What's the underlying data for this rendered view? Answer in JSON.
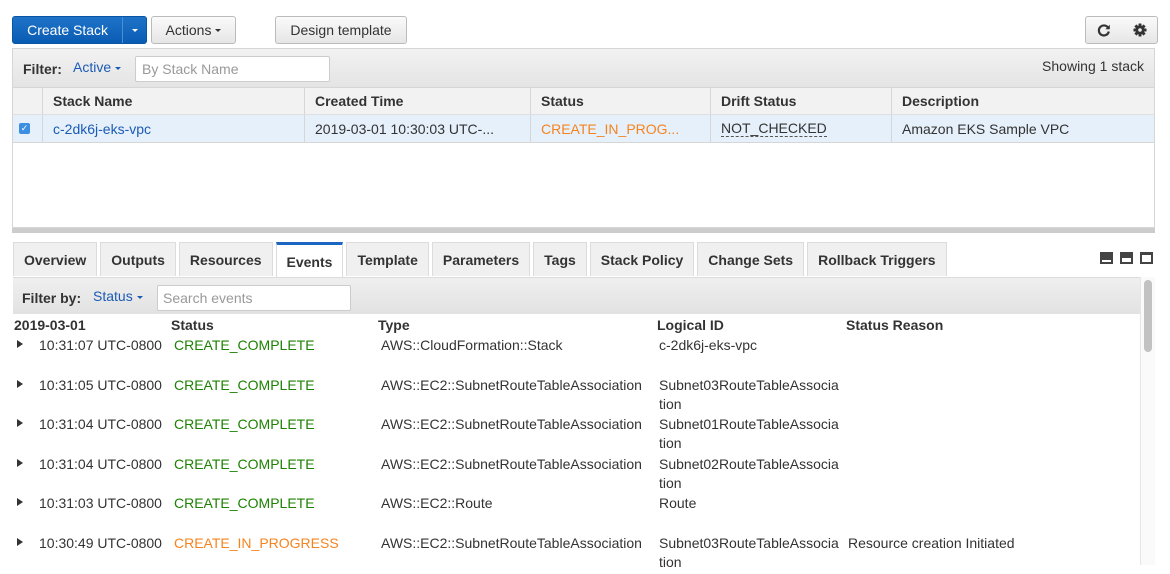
{
  "toolbar": {
    "create_stack": "Create Stack",
    "actions": "Actions",
    "design_template": "Design template",
    "refresh_icon": "refresh-icon",
    "settings_icon": "gear-icon"
  },
  "stack_filter": {
    "label": "Filter:",
    "selected": "Active",
    "placeholder": "By Stack Name",
    "value": "",
    "showing": "Showing 1 stack"
  },
  "stacks_table": {
    "columns": [
      "Stack Name",
      "Created Time",
      "Status",
      "Drift Status",
      "Description"
    ],
    "rows": [
      {
        "selected": true,
        "name": "c-2dk6j-eks-vpc",
        "created": "2019-03-01 10:30:03 UTC-...",
        "status": "CREATE_IN_PROG...",
        "drift": "NOT_CHECKED",
        "description": "Amazon EKS Sample VPC"
      }
    ]
  },
  "tabs": [
    {
      "label": "Overview",
      "active": false
    },
    {
      "label": "Outputs",
      "active": false
    },
    {
      "label": "Resources",
      "active": false
    },
    {
      "label": "Events",
      "active": true
    },
    {
      "label": "Template",
      "active": false
    },
    {
      "label": "Parameters",
      "active": false
    },
    {
      "label": "Tags",
      "active": false
    },
    {
      "label": "Stack Policy",
      "active": false
    },
    {
      "label": "Change Sets",
      "active": false
    },
    {
      "label": "Rollback Triggers",
      "active": false
    }
  ],
  "events_filter": {
    "label": "Filter by:",
    "selected": "Status",
    "placeholder": "Search events",
    "value": ""
  },
  "events_table": {
    "columns": [
      "2019-03-01",
      "Status",
      "Type",
      "Logical ID",
      "Status Reason"
    ],
    "rows": [
      {
        "time": "10:31:07 UTC-0800",
        "status": "CREATE_COMPLETE",
        "status_kind": "complete",
        "type": "AWS::CloudFormation::Stack",
        "logical_id": "c-2dk6j-eks-vpc",
        "reason": ""
      },
      {
        "time": "10:31:05 UTC-0800",
        "status": "CREATE_COMPLETE",
        "status_kind": "complete",
        "type": "AWS::EC2::SubnetRouteTableAssociation",
        "logical_id": "Subnet03RouteTableAssociation",
        "reason": ""
      },
      {
        "time": "10:31:04 UTC-0800",
        "status": "CREATE_COMPLETE",
        "status_kind": "complete",
        "type": "AWS::EC2::SubnetRouteTableAssociation",
        "logical_id": "Subnet01RouteTableAssociation",
        "reason": ""
      },
      {
        "time": "10:31:04 UTC-0800",
        "status": "CREATE_COMPLETE",
        "status_kind": "complete",
        "type": "AWS::EC2::SubnetRouteTableAssociation",
        "logical_id": "Subnet02RouteTableAssociation",
        "reason": ""
      },
      {
        "time": "10:31:03 UTC-0800",
        "status": "CREATE_COMPLETE",
        "status_kind": "complete",
        "type": "AWS::EC2::Route",
        "logical_id": "Route",
        "reason": ""
      },
      {
        "time": "10:30:49 UTC-0800",
        "status": "CREATE_IN_PROGRESS",
        "status_kind": "in_progress",
        "type": "AWS::EC2::SubnetRouteTableAssociation",
        "logical_id": "Subnet03RouteTableAssociation",
        "reason": "Resource creation Initiated"
      }
    ]
  },
  "colors": {
    "primary": "#0a5cb3",
    "link": "#1a5bb5",
    "in_progress": "#f5841f",
    "complete": "#1d8102",
    "selected_row": "#e6f0fa"
  }
}
